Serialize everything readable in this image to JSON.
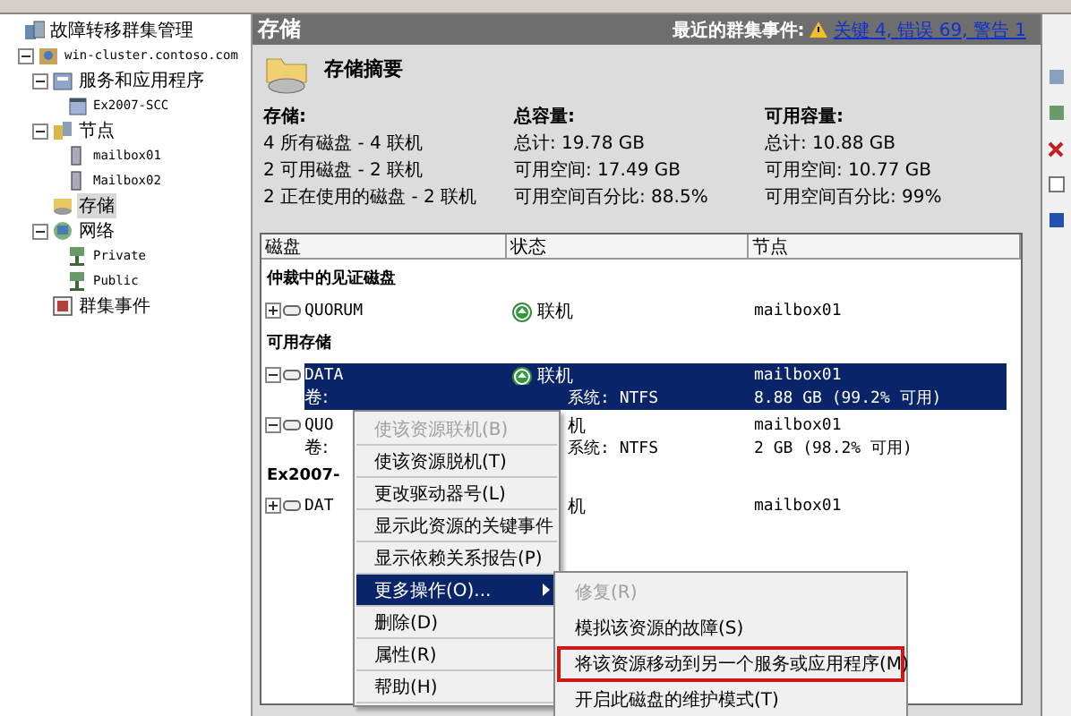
{
  "tree": [
    {
      "label": "故障转移群集管理",
      "selected": false,
      "children": [
        {
          "label": "win-cluster.contoso.com",
          "selected": false,
          "expanded": true,
          "children": [
            {
              "label": "服务和应用程序",
              "selected": false,
              "expanded": true,
              "children": [
                {
                  "label": "Ex2007-SCC",
                  "selected": false
                }
              ]
            },
            {
              "label": "节点",
              "selected": false,
              "expanded": true,
              "children": [
                {
                  "label": "mailbox01",
                  "selected": false
                },
                {
                  "label": "Mailbox02",
                  "selected": false
                }
              ]
            },
            {
              "label": "存储",
              "selected": true
            },
            {
              "label": "网络",
              "selected": false,
              "expanded": true,
              "children": [
                {
                  "label": "Private",
                  "selected": false
                },
                {
                  "label": "Public",
                  "selected": false
                }
              ]
            },
            {
              "label": "群集事件",
              "selected": false
            }
          ]
        }
      ]
    }
  ],
  "header": {
    "title": "存储",
    "events_label": "最近的群集事件:",
    "events_link": "关键 4, 错误 69, 警告 1"
  },
  "summary": {
    "title": "存储摘要",
    "columns": [
      {
        "heading": "存储:",
        "lines": [
          "4 所有磁盘 - 4 联机",
          "2 可用磁盘 - 2 联机",
          "2 正在使用的磁盘 - 2 联机"
        ]
      },
      {
        "heading": "总容量:",
        "lines": [
          "总计: 19.78 GB",
          "可用空间: 17.49 GB",
          "可用空间百分比: 88.5%"
        ]
      },
      {
        "heading": "可用容量:",
        "lines": [
          "总计: 10.88 GB",
          "可用空间: 10.77 GB",
          "可用空间百分比: 99%"
        ]
      }
    ]
  },
  "table": {
    "columns": [
      "磁盘",
      "状态",
      "节点"
    ],
    "groups": [
      {
        "title": "仲裁中的见证磁盘",
        "rows": [
          {
            "disk": "QUORUM",
            "status": "联机",
            "node": "mailbox01",
            "expanded": false,
            "selected": false
          }
        ]
      },
      {
        "title": "可用存储",
        "rows": [
          {
            "disk": "DATA",
            "status": "联机",
            "node": "mailbox01",
            "expanded": true,
            "selected": true,
            "volume": {
              "label": "卷:",
              "fs": "系统: NTFS",
              "capacity": "8.88 GB (99.2% 可用)"
            }
          },
          {
            "disk": "QUO",
            "status": "机",
            "node": "mailbox01",
            "expanded": true,
            "selected": false,
            "volume": {
              "label": "卷:",
              "fs": "系统: NTFS",
              "capacity": "2 GB (98.2% 可用)"
            }
          }
        ]
      },
      {
        "title": "Ex2007-",
        "rows": [
          {
            "disk": "DAT",
            "status": "机",
            "node": "mailbox01",
            "expanded": false,
            "selected": false
          }
        ]
      }
    ]
  },
  "context_menu": [
    {
      "label": "使该资源联机(B)",
      "kind": "item",
      "disabled": true,
      "selected": false
    },
    {
      "label": "使该资源脱机(T)",
      "kind": "item",
      "disabled": false,
      "selected": false
    },
    {
      "label": "更改驱动器号(L)",
      "kind": "item",
      "disabled": false,
      "selected": false
    },
    {
      "label": "显示此资源的关键事件",
      "kind": "item",
      "disabled": false,
      "selected": false
    },
    {
      "label": "显示依赖关系报告(P)",
      "kind": "item",
      "disabled": false,
      "selected": false
    },
    {
      "label": "更多操作(O)...",
      "kind": "submenu",
      "disabled": false,
      "selected": true
    },
    {
      "label": "删除(D)",
      "kind": "item",
      "disabled": false,
      "selected": false
    },
    {
      "label": "属性(R)",
      "kind": "item",
      "disabled": false,
      "selected": false
    },
    {
      "label": "帮助(H)",
      "kind": "item",
      "disabled": false,
      "selected": false
    }
  ],
  "submenu": [
    {
      "label": "修复(R)",
      "disabled": true,
      "marked": false
    },
    {
      "label": "模拟该资源的故障(S)",
      "disabled": false,
      "marked": false
    },
    {
      "label": "将该资源移动到另一个服务或应用程序(M)",
      "disabled": false,
      "marked": true
    },
    {
      "label": "开启此磁盘的维护模式(T)",
      "disabled": false,
      "marked": false
    }
  ]
}
